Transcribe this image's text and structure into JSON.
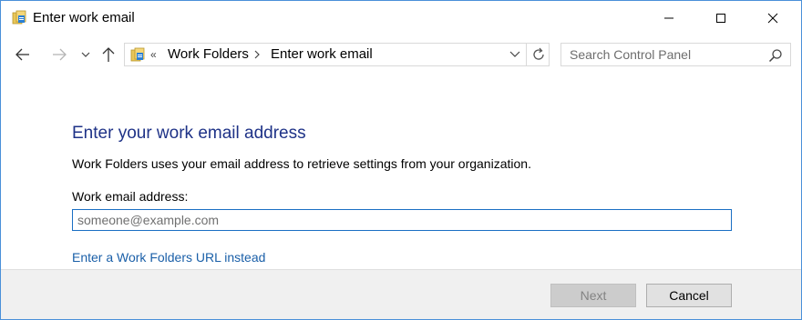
{
  "window": {
    "title": "Enter work email",
    "border_color": "#4a90d9"
  },
  "caption_buttons": {
    "minimize_icon": "minimize-icon",
    "maximize_icon": "maximize-icon",
    "close_icon": "close-icon"
  },
  "navigation": {
    "back_icon": "back-arrow-icon",
    "forward_icon": "forward-arrow-icon",
    "recent_icon": "chevron-down-icon",
    "up_icon": "up-arrow-icon"
  },
  "address_bar": {
    "overflow_chevrons": "«",
    "breadcrumbs": [
      "Work Folders",
      "Enter work email"
    ],
    "dropdown_icon": "chevron-down-icon",
    "refresh_icon": "refresh-icon"
  },
  "search": {
    "placeholder": "Search Control Panel",
    "icon": "search-icon"
  },
  "content": {
    "heading": "Enter your work email address",
    "description": "Work Folders uses your email address to retrieve settings from your organization.",
    "field_label": "Work email address:",
    "email_value": "",
    "email_placeholder": "someone@example.com",
    "alt_link": "Enter a Work Folders URL instead",
    "heading_color": "#1e3287",
    "link_color": "#1a5fa8"
  },
  "footer": {
    "next_label": "Next",
    "next_enabled": false,
    "cancel_label": "Cancel"
  }
}
